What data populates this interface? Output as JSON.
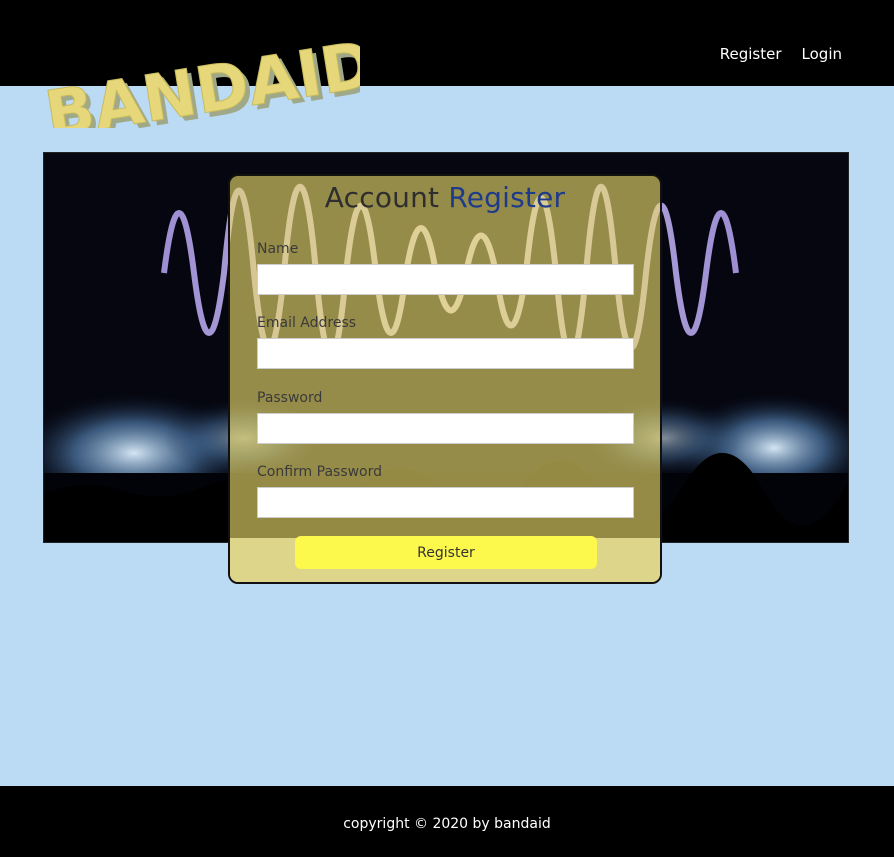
{
  "brand": {
    "logo_text": "BANDAID",
    "logo_color": "#e6d87a",
    "logo_shadow": "#9fa98a"
  },
  "nav": {
    "items": [
      {
        "label": "Register"
      },
      {
        "label": "Login"
      }
    ]
  },
  "form": {
    "title_part1": "Account",
    "title_part2": "Register",
    "fields": [
      {
        "label": "Name",
        "value": ""
      },
      {
        "label": "Email Address",
        "value": ""
      },
      {
        "label": "Password",
        "value": ""
      },
      {
        "label": "Confirm Password",
        "value": ""
      }
    ],
    "submit_label": "Register"
  },
  "footer": {
    "copyright": "copyright © 2020 by bandaid"
  },
  "colors": {
    "page_bg": "#bbdaf3",
    "header_bg": "#000000",
    "card_bg": "#f0de6e",
    "accent_blue": "#1e3a8a",
    "button_bg": "#fdf84c"
  }
}
